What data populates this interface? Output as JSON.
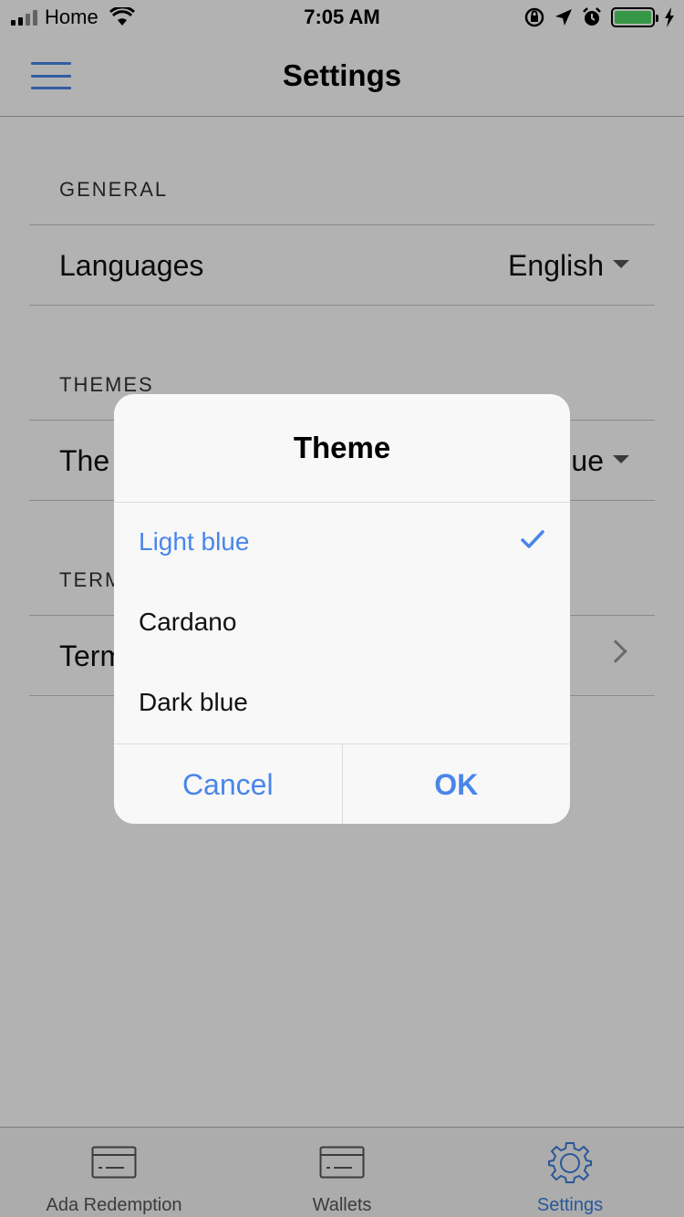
{
  "status_bar": {
    "carrier": "Home",
    "time": "7:05 AM",
    "battery_color": "#4cd964"
  },
  "nav": {
    "title": "Settings",
    "menu_icon": "hamburger-icon"
  },
  "sections": {
    "general": {
      "header": "GENERAL",
      "languages_label": "Languages",
      "languages_value": "English"
    },
    "themes": {
      "header_visible": "THEMES",
      "row_label_visible": "The",
      "row_value_visible": "ue"
    },
    "terms": {
      "header_visible": "TERM",
      "row_label_visible": "Term"
    }
  },
  "dialog": {
    "title": "Theme",
    "options": [
      {
        "label": "Light blue",
        "selected": true
      },
      {
        "label": "Cardano",
        "selected": false
      },
      {
        "label": "Dark blue",
        "selected": false
      }
    ],
    "cancel_label": "Cancel",
    "ok_label": "OK",
    "accent_color": "#4a86e8"
  },
  "tabs": [
    {
      "label": "Ada Redemption",
      "icon": "card-icon",
      "active": false
    },
    {
      "label": "Wallets",
      "icon": "card-icon",
      "active": false
    },
    {
      "label": "Settings",
      "icon": "gear-icon",
      "active": true
    }
  ]
}
